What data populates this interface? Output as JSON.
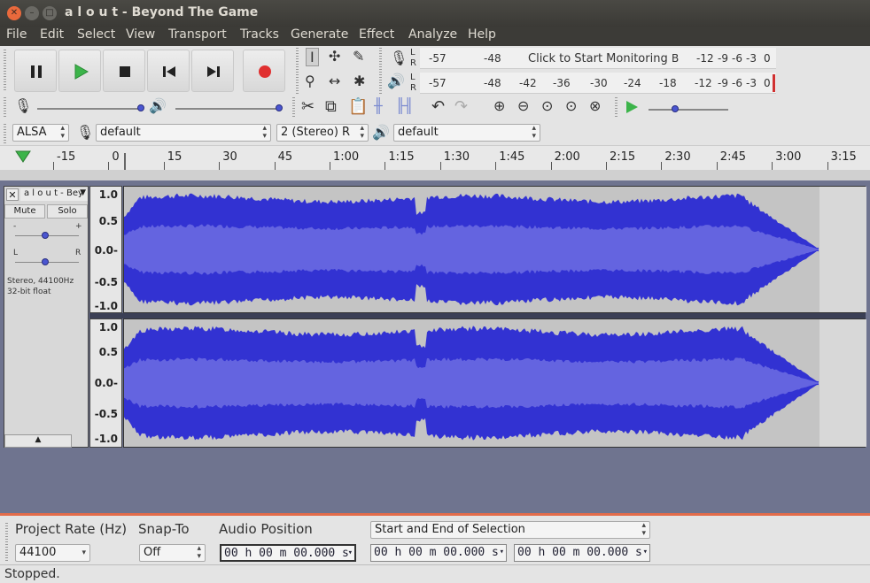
{
  "window": {
    "title": "a l o u t - Beyond The Game"
  },
  "menu": [
    "File",
    "Edit",
    "Select",
    "View",
    "Transport",
    "Tracks",
    "Generate",
    "Effect",
    "Analyze",
    "Help"
  ],
  "meters": {
    "record_scale": [
      "-57",
      "-48",
      "Click to Start Monitoring",
      "B",
      "-12",
      "-9",
      "-6",
      "-3",
      "0"
    ],
    "play_scale": [
      "-57",
      "-48",
      "-42",
      "-36",
      "-30",
      "-24",
      "-18",
      "-12",
      "-9",
      "-6",
      "-3",
      "0"
    ],
    "lr": [
      "L",
      "R"
    ]
  },
  "devices": {
    "host": "ALSA",
    "input": "default",
    "channels": "2 (Stereo) R",
    "output": "default"
  },
  "ruler": {
    "labels": [
      "-15",
      "0",
      "15",
      "30",
      "45",
      "1:00",
      "1:15",
      "1:30",
      "1:45",
      "2:00",
      "2:15",
      "2:30",
      "2:45",
      "3:00",
      "3:15"
    ]
  },
  "track": {
    "name": "a l o u t - Bey",
    "mute": "Mute",
    "solo": "Solo",
    "gain_minus": "-",
    "gain_plus": "+",
    "pan_left": "L",
    "pan_right": "R",
    "info_line1": "Stereo, 44100Hz",
    "info_line2": "32-bit float",
    "scale": [
      "1.0",
      "0.5",
      "0.0-",
      "-0.5",
      "-1.0"
    ]
  },
  "selection_bar": {
    "project_rate_label": "Project Rate (Hz)",
    "project_rate_value": "44100",
    "snap_label": "Snap-To",
    "snap_value": "Off",
    "audio_position_label": "Audio Position",
    "audio_position_value": "00 h 00 m 00.000 s",
    "selection_mode": "Start and End of Selection",
    "selection_start": "00 h 00 m 00.000 s",
    "selection_end": "00 h 00 m 00.000 s"
  },
  "status": "Stopped.",
  "colors": {
    "wave_dark": "#3232d2",
    "wave_light": "#6464e0",
    "record": "#e03030",
    "play": "#3cb44a"
  }
}
